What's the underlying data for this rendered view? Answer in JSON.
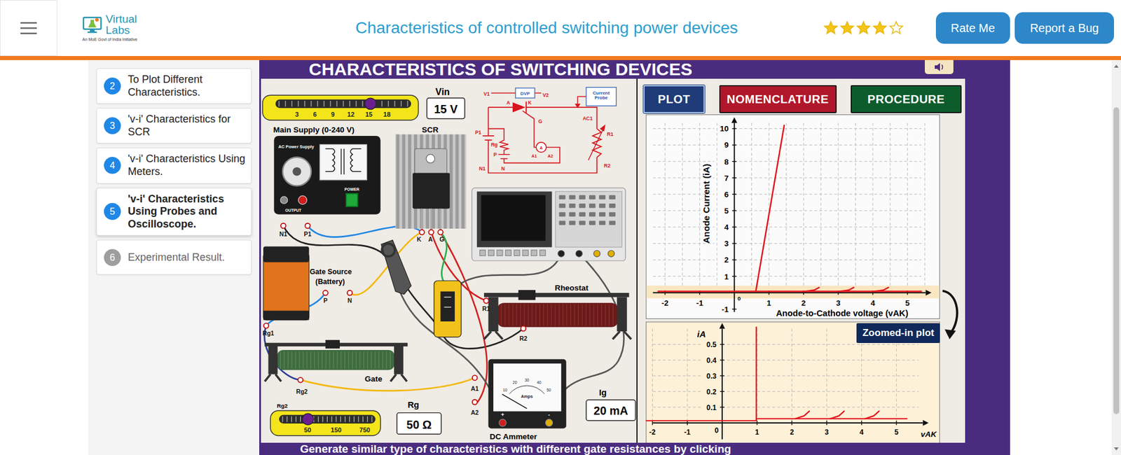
{
  "header": {
    "logo": {
      "line1": "Virtual",
      "line2": "Labs",
      "tagline": "An MoE Govt of India Initiative"
    },
    "title": "Characteristics of controlled switching power devices",
    "rating": {
      "stars": 4,
      "max": 5
    },
    "buttons": [
      "Rate Me",
      "Report a Bug"
    ]
  },
  "sidebar": {
    "items": [
      {
        "number": "2",
        "label": "To Plot Different Characteristics.",
        "selected": false,
        "disabled": false
      },
      {
        "number": "3",
        "label": "'v-i' Characteristics for SCR",
        "selected": false,
        "disabled": false
      },
      {
        "number": "4",
        "label": "'v-i' Characteristics Using Meters.",
        "selected": false,
        "disabled": false
      },
      {
        "number": "5",
        "label": "'v-i' Characteristics Using Probes and Oscilloscope.",
        "selected": true,
        "disabled": false
      },
      {
        "number": "6",
        "label": "Experimental Result.",
        "selected": false,
        "disabled": true
      }
    ]
  },
  "simulation": {
    "title": "CHARACTERISTICS OF SWITCHING DEVICES",
    "footer": "Generate similar type of characteristics with different gate resistances by clicking",
    "tabs": [
      {
        "label": "PLOT",
        "selected": true,
        "color": "#1f3c78"
      },
      {
        "label": "NOMENCLATURE",
        "selected": false,
        "color": "#b0172a"
      },
      {
        "label": "PROCEDURE",
        "selected": false,
        "color": "#0d5c2b"
      }
    ],
    "vin_slider": {
      "label": "Vin",
      "reading": "15 V",
      "level": 0.7,
      "ticks": [
        "3",
        "6",
        "9",
        "12",
        "15",
        "18"
      ]
    },
    "rg_slider": {
      "label": "Rg2",
      "level": 0.3,
      "ticks": [
        "50",
        "150",
        "750"
      ]
    },
    "rg_display": {
      "label": "Rg",
      "reading": "50 Ω"
    },
    "ig_display": {
      "label": "Ig",
      "reading": "20 mA"
    },
    "main_supply": {
      "label": "Main Supply (0-240 V)",
      "panel": "AC Power Supply",
      "power": "POWER",
      "output": "OUTPUT"
    },
    "scr": {
      "label": "SCR"
    },
    "gate_source": {
      "label": "Gate Source",
      "note": "(Battery)"
    },
    "rheostat": {
      "label": "Rheostat"
    },
    "gate_rheostat": {
      "label": "Gate"
    },
    "ammeter": {
      "label": "DC Ammeter",
      "unit": "Amps",
      "scale": [
        "10",
        "20",
        "30",
        "40",
        "50"
      ],
      "plus": "+",
      "minus": "-",
      "level": 0
    },
    "terminals": {
      "n1": "N1",
      "p1": "P1",
      "k": "K",
      "a": "A",
      "g": "G",
      "p": "P",
      "n": "N",
      "rg1": "Rg1",
      "r1": "R1",
      "r2": "R2",
      "rg2": "Rg2",
      "a1": "A1",
      "a2": "A2"
    },
    "schematic": {
      "v1": "V1",
      "dvp": "DVP",
      "v2": "V2",
      "anode": "A",
      "cathode": "K",
      "gate": "G",
      "p1": "P1",
      "n1": "N1",
      "rg": "Rg",
      "p": "P",
      "n": "N",
      "meter": "A",
      "a1": "A1",
      "a2": "A2",
      "probe": "Current Probe",
      "ac1": "AC1",
      "r1": "R1",
      "r2": "R2"
    }
  },
  "main_plot": {
    "y_label": "Anode Current (iA)",
    "x_label": "Anode-to-Cathode voltage (vAK)",
    "origin": "0",
    "x_ticks": [
      {
        "label": "-2",
        "value": -2
      },
      {
        "label": "-1",
        "value": -1
      },
      {
        "label": "1",
        "value": 1
      },
      {
        "label": "2",
        "value": 2
      },
      {
        "label": "3",
        "value": 3
      },
      {
        "label": "4",
        "value": 4
      },
      {
        "label": "5",
        "value": 5
      }
    ],
    "y_ticks": [
      {
        "label": "-1",
        "value": -1
      },
      {
        "label": "1",
        "value": 1
      },
      {
        "label": "2",
        "value": 2
      },
      {
        "label": "3",
        "value": 3
      },
      {
        "label": "4",
        "value": 4
      },
      {
        "label": "5",
        "value": 5
      },
      {
        "label": "6",
        "value": 6
      },
      {
        "label": "7",
        "value": 7
      },
      {
        "label": "8",
        "value": 8
      },
      {
        "label": "9",
        "value": 9
      },
      {
        "label": "10",
        "value": 10
      }
    ],
    "series": [
      {
        "x": [
          -2.2,
          0.62,
          1.44
        ],
        "y": [
          0.08,
          0.08,
          10.2
        ]
      },
      {
        "x": [
          0.62,
          5.4
        ],
        "y": [
          0.08,
          0.08
        ]
      },
      {
        "x": [
          2.05,
          2.3,
          2.45
        ],
        "y": [
          0.08,
          0.15,
          0.32
        ]
      },
      {
        "x": [
          3.05,
          3.3,
          3.45
        ],
        "y": [
          0.08,
          0.15,
          0.32
        ]
      },
      {
        "x": [
          4.05,
          4.3,
          4.45
        ],
        "y": [
          0.08,
          0.15,
          0.32
        ]
      }
    ]
  },
  "zoom_plot": {
    "badge": "Zoomed-in plot",
    "y_label": "iA",
    "x_label": "vAK",
    "origin": "0",
    "x_ticks": [
      {
        "label": "-2",
        "value": -2
      },
      {
        "label": "-1",
        "value": -1
      },
      {
        "label": "1",
        "value": 1
      },
      {
        "label": "2",
        "value": 2
      },
      {
        "label": "3",
        "value": 3
      },
      {
        "label": "4",
        "value": 4
      },
      {
        "label": "5",
        "value": 5
      }
    ],
    "y_ticks": [
      {
        "label": "0.1",
        "value": 0.1
      },
      {
        "label": "0.2",
        "value": 0.2
      },
      {
        "label": "0.3",
        "value": 0.3
      },
      {
        "label": "0.4",
        "value": 0.4
      },
      {
        "label": "0.5",
        "value": 0.5
      }
    ],
    "series": [
      {
        "x": [
          -2.2,
          0.98,
          0.98
        ],
        "y": [
          0.014,
          0.014,
          0.61
        ]
      },
      {
        "x": [
          0.98,
          5.3
        ],
        "y": [
          0.027,
          0.027
        ]
      },
      {
        "x": [
          2.1,
          2.35,
          2.5
        ],
        "y": [
          0.027,
          0.045,
          0.075
        ]
      },
      {
        "x": [
          3.1,
          3.35,
          3.5
        ],
        "y": [
          0.027,
          0.045,
          0.075
        ]
      },
      {
        "x": [
          4.1,
          4.35,
          4.5
        ],
        "y": [
          0.027,
          0.045,
          0.075
        ]
      }
    ]
  }
}
